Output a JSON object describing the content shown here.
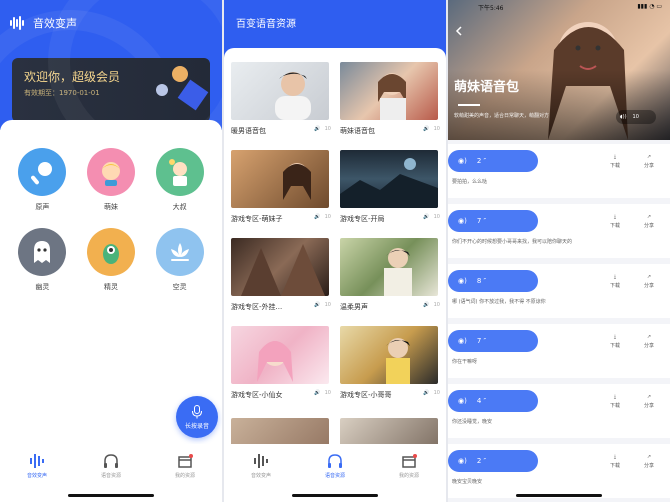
{
  "colors": {
    "primary": "#2f5ef0",
    "accent": "#3a6cf4",
    "gold": "#f4d58d"
  },
  "panel1": {
    "app_title": "音效变声",
    "vip": {
      "welcome": "欢迎你，超级会员",
      "expire": "有效期至：1970-01-01"
    },
    "voices": [
      {
        "label": "原声",
        "icon": "microphone-avatar-icon",
        "color": "#4aa0ec"
      },
      {
        "label": "萌妹",
        "icon": "cute-girl-avatar-icon",
        "color": "#f48eb1"
      },
      {
        "label": "大叔",
        "icon": "uncle-avatar-icon",
        "color": "#5ec08f"
      },
      {
        "label": "幽灵",
        "icon": "ghost-avatar-icon",
        "color": "#6d7583"
      },
      {
        "label": "精灵",
        "icon": "goblin-avatar-icon",
        "color": "#f2b04f"
      },
      {
        "label": "空灵",
        "icon": "lotus-avatar-icon",
        "color": "#8fc3ef"
      }
    ],
    "record_label": "长按录音",
    "tabs": [
      {
        "label": "音效变声",
        "icon": "waveform-icon",
        "active": true
      },
      {
        "label": "语音资源",
        "icon": "headphones-icon",
        "active": false
      },
      {
        "label": "我的资源",
        "icon": "box-icon",
        "active": false
      }
    ]
  },
  "panel2": {
    "title": "百变语音资源",
    "cards": [
      {
        "label": "暖男语音包",
        "count": "10"
      },
      {
        "label": "萌妹语音包",
        "count": "10"
      },
      {
        "label": "游戏专区-萌妹子",
        "count": "10"
      },
      {
        "label": "游戏专区-开局",
        "count": "10"
      },
      {
        "label": "游戏专区-外挂...",
        "count": "10"
      },
      {
        "label": "温柔男声",
        "count": "10"
      },
      {
        "label": "游戏专区-小仙女",
        "count": "10"
      },
      {
        "label": "游戏专区-小哥哥",
        "count": "10"
      }
    ],
    "tabs": [
      {
        "label": "音效变声",
        "icon": "waveform-icon",
        "active": false
      },
      {
        "label": "语音资源",
        "icon": "headphones-icon",
        "active": true
      },
      {
        "label": "我的资源",
        "icon": "box-icon",
        "active": false
      }
    ]
  },
  "panel3": {
    "status_time": "下午5:46",
    "hero_title": "萌妹语音包",
    "hero_sub": "软萌甜美的声音，适合日常聊天，萌翻对方",
    "hero_count": "10",
    "download_label": "下载",
    "share_label": "分享",
    "items": [
      {
        "duration": "2 ″",
        "text": "要拍拍，么么哒"
      },
      {
        "duration": "7 ″",
        "text": "你们不开心的时候想要小哥哥来找，我可以陪你聊天的"
      },
      {
        "duration": "8 ″",
        "text": "哪 (语气词) 你不放过我，我不得 不原谅你"
      },
      {
        "duration": "7 ″",
        "text": "你在干嘛呀"
      },
      {
        "duration": "4 ″",
        "text": "你还没睡觉，晚安"
      },
      {
        "duration": "2 ″",
        "text": "晚安宝贝晚安"
      }
    ]
  }
}
